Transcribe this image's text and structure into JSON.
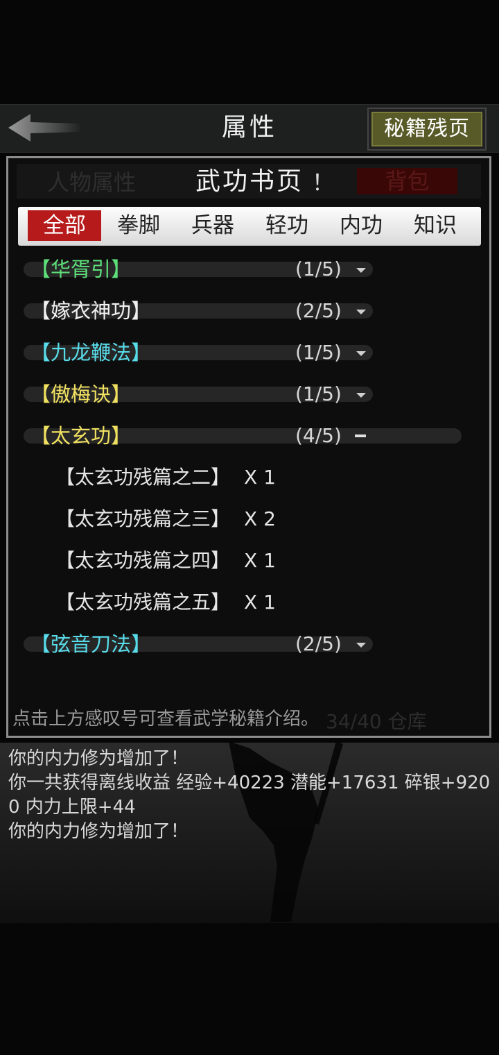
{
  "header": {
    "title": "属性",
    "right_button": "秘籍残页"
  },
  "panel": {
    "ghost_left": "人物属性",
    "ghost_right": "背包",
    "title": "武功书页",
    "info_mark": "！",
    "tabs": [
      {
        "label": "全部",
        "active": true
      },
      {
        "label": "拳脚",
        "active": false
      },
      {
        "label": "兵器",
        "active": false
      },
      {
        "label": "轻功",
        "active": false
      },
      {
        "label": "内功",
        "active": false
      },
      {
        "label": "知识",
        "active": false
      }
    ],
    "rows": [
      {
        "name": "【华胥引】",
        "count": "(1/5)",
        "color": "#5de07a",
        "expanded": false
      },
      {
        "name": "【嫁衣神功】",
        "count": "(2/5)",
        "color": "#f2f2f2",
        "expanded": false
      },
      {
        "name": "【九龙鞭法】",
        "count": "(1/5)",
        "color": "#58dcea",
        "expanded": false
      },
      {
        "name": "【傲梅诀】",
        "count": "(1/5)",
        "color": "#f0e060",
        "expanded": false
      },
      {
        "name": "【太玄功】",
        "count": "(4/5)",
        "color": "#f0e060",
        "expanded": true
      },
      {
        "name": "【弦音刀法】",
        "count": "(2/5)",
        "color": "#58dcea",
        "expanded": false
      }
    ],
    "sub_items": [
      {
        "name": "【太玄功残篇之二】",
        "qty": "X 1"
      },
      {
        "name": "【太玄功残篇之三】",
        "qty": "X 2"
      },
      {
        "name": "【太玄功残篇之四】",
        "qty": "X 1"
      },
      {
        "name": "【太玄功残篇之五】",
        "qty": "X 1"
      }
    ],
    "hint": "点击上方感叹号可查看武学秘籍介绍。",
    "ghost_store": "34/40 仓库"
  },
  "log": {
    "lines": [
      "你的内力修为增加了！",
      "你一共获得离线收益 经验+40223 潜能+17631 碎银+9200 内力上限+44",
      "你的内力修为增加了！"
    ]
  },
  "colors": {
    "active_tab": "#b61a1a",
    "panel_border": "#8d8d8d",
    "right_button_bg": "#585a28"
  }
}
